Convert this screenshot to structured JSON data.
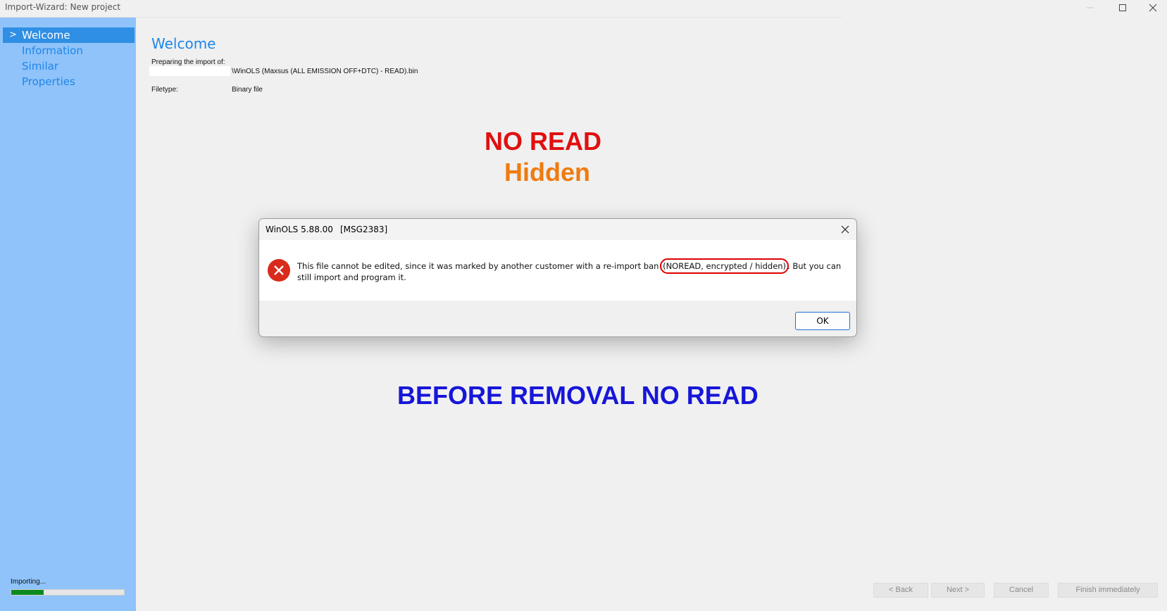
{
  "window": {
    "title": "Import-Wizard: New project",
    "minimize_icon": "minimize-icon",
    "maximize_icon": "maximize-icon",
    "close_icon": "close-icon"
  },
  "sidebar": {
    "items": [
      {
        "label": "Welcome",
        "active": true
      },
      {
        "label": "Information",
        "active": false
      },
      {
        "label": "Similar",
        "active": false
      },
      {
        "label": "Properties",
        "active": false
      }
    ],
    "active_marker": ">",
    "status_text": "Importing...",
    "progress_fraction": 0.29,
    "progress_color": "#0c8a1d"
  },
  "main": {
    "title": "Welcome",
    "preparing_label": "Preparing the import of:",
    "file_name": "\\WinOLS (Maxsus (ALL EMISSION OFF+DTC) - READ).bin",
    "filetype_label": "Filetype:",
    "filetype_value": "Binary file"
  },
  "annotations": {
    "no_read": "NO READ",
    "hidden": "Hidden",
    "before": "BEFORE REMOVAL NO READ",
    "colors": {
      "no_read": "#e01010",
      "hidden": "#ef7b10",
      "before": "#1616d8",
      "highlight": "#e00000"
    }
  },
  "dialog": {
    "title": "WinOLS 5.88.00",
    "code": "[MSG2383]",
    "icon": "error-icon",
    "message_before": "This file cannot be edited, since it was marked by another customer with a re-import ban ",
    "message_highlight": "(NOREAD, encrypted / hidden)",
    "message_after": ". But you can still import and program it.",
    "ok_label": "OK"
  },
  "footer": {
    "back_label": "< Back",
    "next_label": "Next >",
    "cancel_label": "Cancel",
    "finish_label": "Finish immediately"
  }
}
